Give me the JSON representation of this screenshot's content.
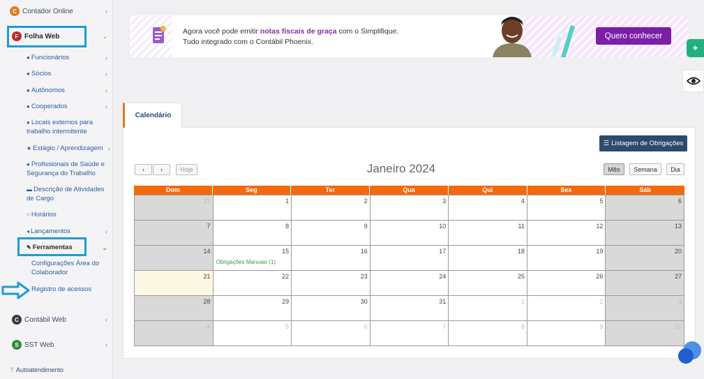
{
  "sidebar": {
    "contador_online": "Contador Online",
    "folha_web": "Folha Web",
    "items": [
      {
        "label": "Funcionários",
        "icon": "user-circle-icon",
        "has_chevron": true
      },
      {
        "label": "Sócios",
        "icon": "users-icon",
        "has_chevron": true
      },
      {
        "label": "Autônomos",
        "icon": "thumbs-up-icon",
        "has_chevron": true
      },
      {
        "label": "Cooperados",
        "icon": "handshake-icon",
        "has_chevron": true
      },
      {
        "label": "Locais externos para trabalho intermitente",
        "icon": "globe-icon",
        "has_chevron": false
      },
      {
        "label": "Estágio / Aprendizagem",
        "icon": "star-icon",
        "has_chevron": true
      },
      {
        "label": "Profissionais de Saúde e Segurança do Trabalho",
        "icon": "medkit-icon",
        "has_chevron": false
      },
      {
        "label": "Descrição de Atividades de Cargo",
        "icon": "id-card-icon",
        "has_chevron": false
      },
      {
        "label": "Horários",
        "icon": "clock-icon",
        "has_chevron": false
      },
      {
        "label": "Lançamentos",
        "icon": "bullhorn-icon",
        "has_chevron": true
      }
    ],
    "ferramentas": "Ferramentas",
    "ferramentas_items": [
      "Configurações Área do Colaborador",
      "Registro de acessos"
    ],
    "contabil_web": "Contábil Web",
    "sst_web": "SST Web",
    "autoatendimento": "Autoatendimento"
  },
  "banner": {
    "line1_prefix": "Agora você pode emitir ",
    "line1_highlight": "notas fiscais de graça",
    "line1_suffix": " com o Simplifique.",
    "line2": "Tudo integrado com o Contábil Phoenix.",
    "button": "Quero conhecer",
    "accent": "#7a1fa8"
  },
  "tab": "Calendário",
  "listing_button": "Listagem de Obrigações",
  "calendar": {
    "today_button": "Hoje",
    "title": "Janeiro 2024",
    "views": [
      "Mês",
      "Semana",
      "Dia"
    ],
    "active_view": "Mês",
    "weekdays": [
      "Dom",
      "Seg",
      "Ter",
      "Qua",
      "Qui",
      "Sex",
      "Sáb"
    ],
    "weeks": [
      [
        {
          "d": "31",
          "other": true
        },
        {
          "d": "1"
        },
        {
          "d": "2"
        },
        {
          "d": "3"
        },
        {
          "d": "4"
        },
        {
          "d": "5"
        },
        {
          "d": "6"
        }
      ],
      [
        {
          "d": "7"
        },
        {
          "d": "8"
        },
        {
          "d": "9"
        },
        {
          "d": "10"
        },
        {
          "d": "11"
        },
        {
          "d": "12"
        },
        {
          "d": "13"
        }
      ],
      [
        {
          "d": "14"
        },
        {
          "d": "15",
          "event": "Obrigações Manuais (1)"
        },
        {
          "d": "16"
        },
        {
          "d": "17"
        },
        {
          "d": "18"
        },
        {
          "d": "19"
        },
        {
          "d": "20"
        }
      ],
      [
        {
          "d": "21",
          "today": true
        },
        {
          "d": "22"
        },
        {
          "d": "23"
        },
        {
          "d": "24"
        },
        {
          "d": "25"
        },
        {
          "d": "26"
        },
        {
          "d": "27"
        }
      ],
      [
        {
          "d": "28"
        },
        {
          "d": "29"
        },
        {
          "d": "30"
        },
        {
          "d": "31"
        },
        {
          "d": "1",
          "other": true
        },
        {
          "d": "2",
          "other": true
        },
        {
          "d": "3",
          "other": true
        }
      ],
      [
        {
          "d": "4",
          "other": true
        },
        {
          "d": "5",
          "other": true
        },
        {
          "d": "6",
          "other": true
        },
        {
          "d": "7",
          "other": true
        },
        {
          "d": "8",
          "other": true
        },
        {
          "d": "9",
          "other": true
        },
        {
          "d": "10",
          "other": true
        }
      ]
    ],
    "header_color": "#f26a10"
  }
}
